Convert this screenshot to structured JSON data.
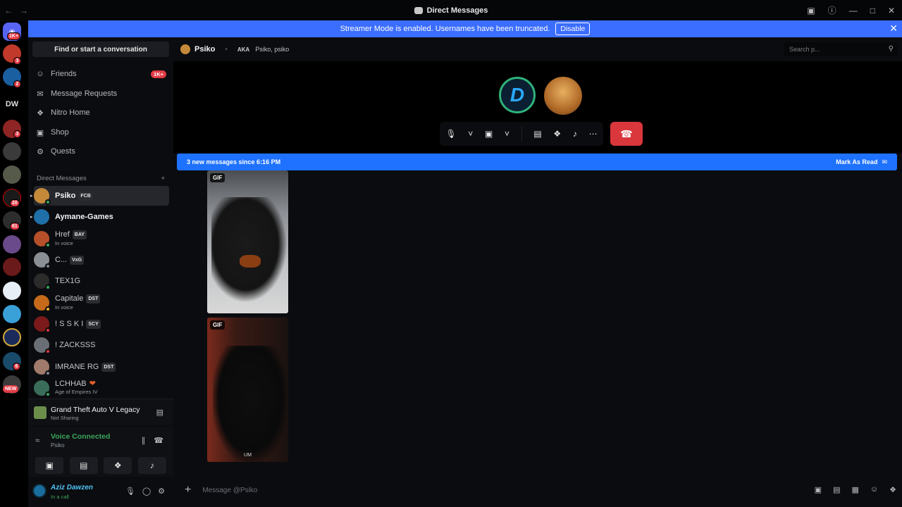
{
  "window": {
    "title": "Direct Messages"
  },
  "banner": {
    "text": "Streamer Mode is enabled. Usernames have been truncated.",
    "button": "Disable"
  },
  "rail": {
    "badges": [
      "1K+",
      "3",
      "2",
      "3",
      "20",
      "61",
      "6"
    ],
    "dw_label": "DW",
    "new_label": "NEW"
  },
  "sidebar": {
    "find": "Find or start a conversation",
    "nav": [
      {
        "label": "Friends",
        "icon": "friends-icon",
        "count": "1K+"
      },
      {
        "label": "Message Requests",
        "icon": "mail-icon"
      },
      {
        "label": "Nitro Home",
        "icon": "nitro-icon"
      },
      {
        "label": "Shop",
        "icon": "shop-icon"
      },
      {
        "label": "Quests",
        "icon": "quests-icon"
      }
    ],
    "dm_header": "Direct Messages",
    "dm_add": "+",
    "dms": [
      {
        "name": "Psiko",
        "tag": "FCB",
        "sub": "",
        "color": "#c48a3a",
        "status": "#3ba55c"
      },
      {
        "name": "Aymane-Games",
        "tag": "",
        "sub": "",
        "color": "#1f6fa8",
        "status": ""
      },
      {
        "name": "Href",
        "tag": "BAY",
        "sub": "In voice",
        "color": "#b5502a",
        "status": "#3ba55c"
      },
      {
        "name": "C...",
        "tag": "VxG",
        "sub": "",
        "color": "#8a8f96",
        "status": "#80848e"
      },
      {
        "name": "TEX1G",
        "tag": "",
        "sub": "",
        "color": "#2b2b2b",
        "status": "#3ba55c"
      },
      {
        "name": "Capitale",
        "tag": "DST",
        "sub": "In voice",
        "color": "#c46a1a",
        "status": "#f0b232"
      },
      {
        "name": "! S S K I",
        "tag": "SCY",
        "sub": "",
        "color": "#7a1a1a",
        "status": "#da373c"
      },
      {
        "name": "! ZACKSSS",
        "tag": "",
        "sub": "",
        "color": "#6a6e75",
        "status": "#da373c"
      },
      {
        "name": "IMRANE RG",
        "tag": "DST",
        "sub": "",
        "color": "#a07a6a",
        "status": "#80848e"
      },
      {
        "name": "LCHHAB",
        "tag": "",
        "sub": "Age of Empires IV",
        "color": "#3a6e5a",
        "status": "#3ba55c"
      }
    ]
  },
  "activity": {
    "game": "Grand Theft Auto V Legacy",
    "state": "Not Sharing"
  },
  "voice": {
    "status": "Voice Connected",
    "channel": "Psiko"
  },
  "user": {
    "name": "Aziz Dawzen",
    "status": "In a call"
  },
  "main": {
    "header": {
      "name": "Psiko",
      "aka": "AKA",
      "aka_values": "Psiko, psiko"
    },
    "search_placeholder": "Search p...",
    "new_messages": "3 new messages since 6:16 PM",
    "mark_read": "Mark As Read",
    "gif_label": "GIF",
    "gif2_caption": "UM",
    "composer_placeholder": "Message @Psiko",
    "avatar_letter": "D"
  },
  "colors": {
    "accent": "#3b6dff",
    "new_bar": "#1e72ff",
    "danger": "#da373c",
    "online": "#3ba55c"
  }
}
